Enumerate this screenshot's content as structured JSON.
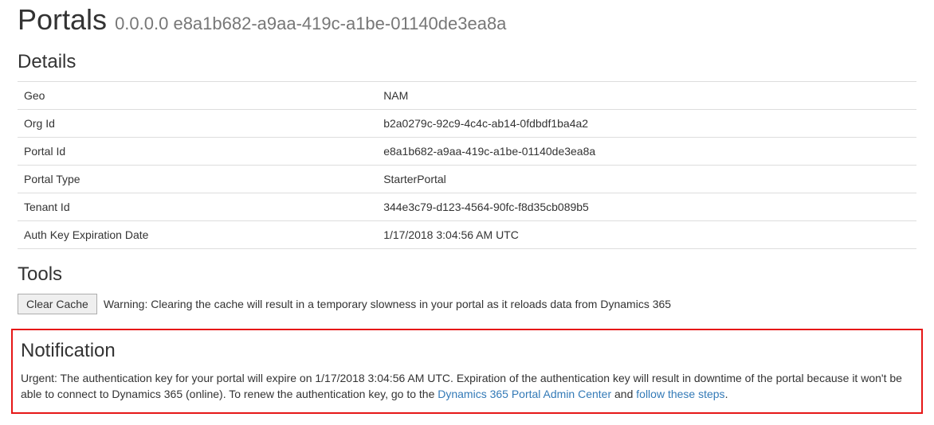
{
  "header": {
    "title": "Portals",
    "subtitle": "0.0.0.0 e8a1b682-a9aa-419c-a1be-01140de3ea8a"
  },
  "details": {
    "heading": "Details",
    "rows": [
      {
        "label": "Geo",
        "value": "NAM"
      },
      {
        "label": "Org Id",
        "value": "b2a0279c-92c9-4c4c-ab14-0fdbdf1ba4a2"
      },
      {
        "label": "Portal Id",
        "value": "e8a1b682-a9aa-419c-a1be-01140de3ea8a"
      },
      {
        "label": "Portal Type",
        "value": "StarterPortal"
      },
      {
        "label": "Tenant Id",
        "value": "344e3c79-d123-4564-90fc-f8d35cb089b5"
      },
      {
        "label": "Auth Key Expiration Date",
        "value": "1/17/2018 3:04:56 AM UTC"
      }
    ]
  },
  "tools": {
    "heading": "Tools",
    "clear_cache_label": "Clear Cache",
    "warning": "Warning: Clearing the cache will result in a temporary slowness in your portal as it reloads data from Dynamics 365"
  },
  "notification": {
    "heading": "Notification",
    "prefix": "Urgent: The authentication key for your portal will expire on 1/17/2018 3:04:56 AM UTC. Expiration of the authentication key will result in downtime of the portal because it won't be able to connect to Dynamics 365 (online). To renew the authentication key, go to the ",
    "link1": "Dynamics 365 Portal Admin Center",
    "mid": " and ",
    "link2": "follow these steps",
    "suffix": "."
  }
}
